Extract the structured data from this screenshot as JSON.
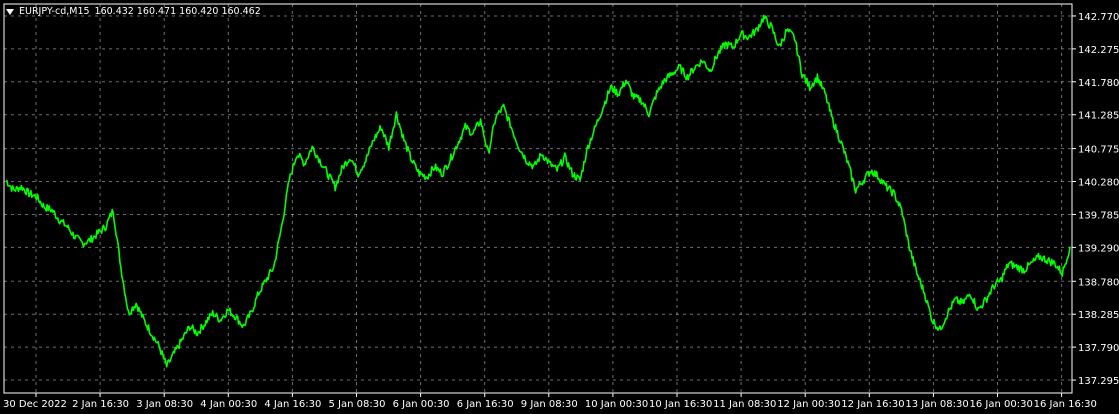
{
  "header": {
    "symbol_label": "EURJPY-cd,M15",
    "ohlc_text": "160.432 160.471 160.420 160.462"
  },
  "colors": {
    "background": "#000000",
    "series": "#00ff00",
    "grid": "#c8c8c8",
    "text": "#ffffff"
  },
  "chart_data": {
    "type": "line",
    "title": "",
    "xlabel": "",
    "ylabel": "",
    "ylim": [
      137.1,
      142.95
    ],
    "grid": true,
    "y_ticks": [
      "142.770",
      "142.275",
      "141.780",
      "141.285",
      "140.775",
      "140.280",
      "139.785",
      "139.290",
      "138.780",
      "138.285",
      "137.790",
      "137.295"
    ],
    "x_ticks": [
      "30 Dec 2022",
      "2 Jan 16:30",
      "3 Jan 08:30",
      "4 Jan 00:30",
      "4 Jan 16:30",
      "5 Jan 08:30",
      "6 Jan 00:30",
      "6 Jan 16:30",
      "9 Jan 08:30",
      "10 Jan 00:30",
      "10 Jan 16:30",
      "11 Jan 08:30",
      "12 Jan 00:30",
      "12 Jan 16:30",
      "13 Jan 08:30",
      "16 Jan 00:30",
      "16 Jan 16:30"
    ],
    "series": [
      {
        "values": [
          140.3,
          140.15,
          140.2,
          140.1,
          140.05,
          139.9,
          139.85,
          139.7,
          139.6,
          139.45,
          139.35,
          139.4,
          139.5,
          139.6,
          139.85,
          139.0,
          138.3,
          138.45,
          138.2,
          138.0,
          137.8,
          137.5,
          137.7,
          137.9,
          138.1,
          138.0,
          138.15,
          138.3,
          138.2,
          138.35,
          138.25,
          138.1,
          138.3,
          138.6,
          138.8,
          139.0,
          139.6,
          140.3,
          140.7,
          140.55,
          140.8,
          140.6,
          140.4,
          140.2,
          140.5,
          140.65,
          140.4,
          140.6,
          140.9,
          141.1,
          140.8,
          141.3,
          140.9,
          140.6,
          140.4,
          140.35,
          140.5,
          140.4,
          140.6,
          140.85,
          141.1,
          141.0,
          141.2,
          140.7,
          141.25,
          141.4,
          141.1,
          140.8,
          140.6,
          140.5,
          140.7,
          140.55,
          140.45,
          140.65,
          140.4,
          140.3,
          140.8,
          141.1,
          141.4,
          141.7,
          141.6,
          141.8,
          141.55,
          141.5,
          141.3,
          141.6,
          141.8,
          141.9,
          142.0,
          141.85,
          142.0,
          142.1,
          141.95,
          142.2,
          142.35,
          142.3,
          142.5,
          142.45,
          142.55,
          142.75,
          142.6,
          142.3,
          142.55,
          142.45,
          141.9,
          141.7,
          141.85,
          141.6,
          141.2,
          140.9,
          140.55,
          140.15,
          140.3,
          140.45,
          140.35,
          140.2,
          140.1,
          139.85,
          139.3,
          138.9,
          138.6,
          138.2,
          138.05,
          138.3,
          138.5,
          138.45,
          138.6,
          138.35,
          138.5,
          138.7,
          138.8,
          139.05,
          139.0,
          138.95,
          139.05,
          139.15,
          139.1,
          139.05,
          138.9,
          139.3
        ]
      }
    ]
  }
}
